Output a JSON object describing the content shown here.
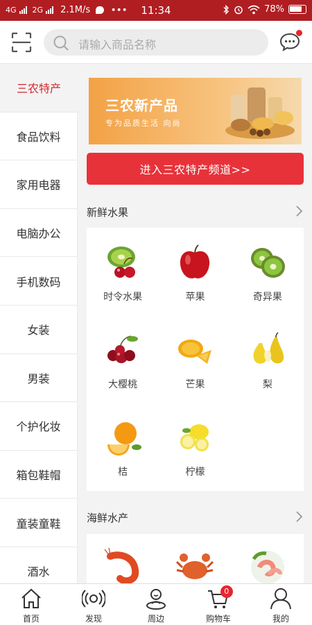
{
  "status_bar": {
    "network1": "4G",
    "network2": "2G",
    "speed": "2.1M/s",
    "time": "11:34",
    "battery": "78%"
  },
  "header": {
    "search_placeholder": "请输入商品名称",
    "scan_icon": "scan-icon",
    "message_icon": "message-icon"
  },
  "sidebar": {
    "items": [
      {
        "label": "三农特产",
        "active": true
      },
      {
        "label": "食品饮料"
      },
      {
        "label": "家用电器"
      },
      {
        "label": "电脑办公"
      },
      {
        "label": "手机数码"
      },
      {
        "label": "女装"
      },
      {
        "label": "男装"
      },
      {
        "label": "个护化妆"
      },
      {
        "label": "箱包鞋帽"
      },
      {
        "label": "童装童鞋"
      },
      {
        "label": "酒水"
      }
    ]
  },
  "banner": {
    "title": "三农新产品",
    "subtitle": "专为品质生活 向尚"
  },
  "enter_button": "进入三农特产频道>>",
  "sections": [
    {
      "title": "新鲜水果",
      "items": [
        {
          "label": "时令水果",
          "icon": "kiwi-cherry-icon"
        },
        {
          "label": "苹果",
          "icon": "apple-icon"
        },
        {
          "label": "奇异果",
          "icon": "kiwi-icon"
        },
        {
          "label": "大樱桃",
          "icon": "cherry-icon"
        },
        {
          "label": "芒果",
          "icon": "mango-icon"
        },
        {
          "label": "梨",
          "icon": "pear-icon"
        },
        {
          "label": "桔",
          "icon": "orange-icon"
        },
        {
          "label": "柠檬",
          "icon": "lemon-icon"
        }
      ]
    },
    {
      "title": "海鲜水产",
      "items": [
        {
          "label": "",
          "icon": "shrimp-icon"
        },
        {
          "label": "",
          "icon": "crab-icon"
        },
        {
          "label": "",
          "icon": "prawn-plate-icon"
        }
      ]
    }
  ],
  "tabbar": {
    "items": [
      {
        "label": "首页",
        "icon": "home-icon"
      },
      {
        "label": "发现",
        "icon": "discover-icon"
      },
      {
        "label": "周边",
        "icon": "nearby-icon"
      },
      {
        "label": "购物车",
        "icon": "cart-icon",
        "badge": "0"
      },
      {
        "label": "我的",
        "icon": "user-icon"
      }
    ]
  },
  "colors": {
    "status_bar": "#b01e22",
    "accent": "#e8323a",
    "active_text": "#d7272c"
  }
}
